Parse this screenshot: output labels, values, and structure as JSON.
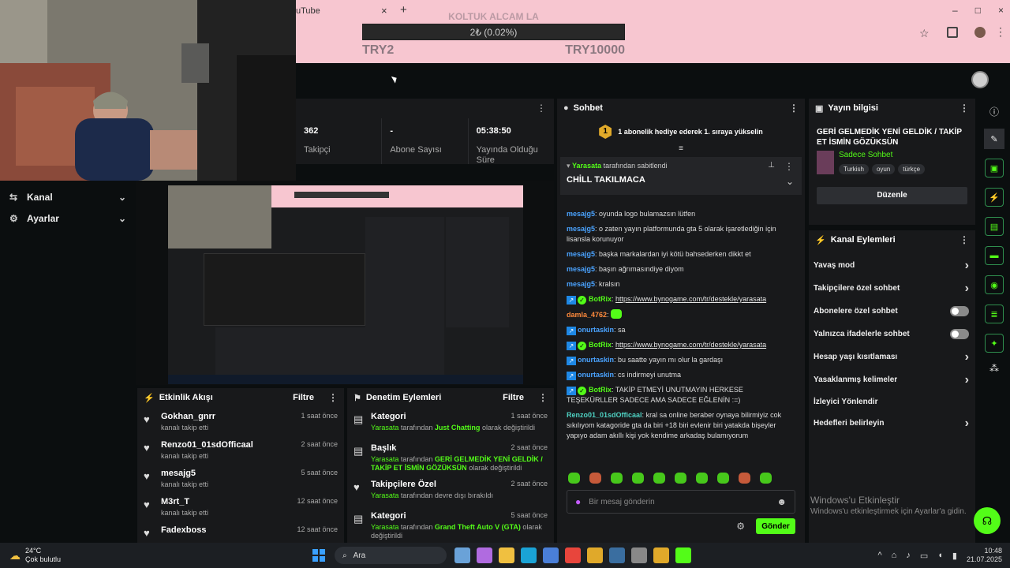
{
  "browser": {
    "tab_title": "uTube",
    "tab_close": "×",
    "new_tab": "+",
    "window_controls": [
      "–",
      "□",
      "×"
    ]
  },
  "goal": {
    "title": "KOLTUK ALCAM LA",
    "progress_text": "2₺ (0.02%)",
    "progress_fraction": 0.0002,
    "min_label": "TRY2",
    "max_label": "TRY10000"
  },
  "stats": [
    {
      "value": "362",
      "label": "Takipçi"
    },
    {
      "value": "-",
      "label": "Abone Sayısı"
    },
    {
      "value": "05:38:50",
      "label": "Yayında Olduğu Süre"
    }
  ],
  "sidebar": {
    "items": [
      {
        "label": "Kanal",
        "icon": "channel-icon"
      },
      {
        "label": "Ayarlar",
        "icon": "gear-icon"
      }
    ]
  },
  "activity_feed": {
    "title": "Etkinlik Akışı",
    "filter": "Filtre",
    "items": [
      {
        "name": "Gokhan_gnrr",
        "sub": "kanalı takip etti",
        "time": "1 saat önce"
      },
      {
        "name": "Renzo01_01sdOfficaal",
        "sub": "kanalı takip etti",
        "time": "2 saat önce"
      },
      {
        "name": "mesajg5",
        "sub": "kanalı takip etti",
        "time": "5 saat önce"
      },
      {
        "name": "M3rt_T",
        "sub": "kanalı takip etti",
        "time": "12 saat önce"
      },
      {
        "name": "Fadexboss",
        "sub": "",
        "time": "12 saat önce"
      }
    ]
  },
  "moderation": {
    "title": "Denetim Eylemleri",
    "filter": "Filtre",
    "items": [
      {
        "title": "Kategori",
        "time": "1 saat önce",
        "actor": "Yarasata",
        "mid": "tarafından",
        "value": "Just Chatting",
        "tail": "olarak değiştirildi"
      },
      {
        "title": "Başlık",
        "time": "2 saat önce",
        "actor": "Yarasata",
        "mid": "tarafından",
        "value": "GERİ GELMEDİK YENİ GELDİK / TAKİP ET İSMİN GÖZÜKSÜN",
        "tail": "olarak değiştirildi"
      },
      {
        "title": "Takipçilere Özel",
        "time": "2 saat önce",
        "actor": "Yarasata",
        "mid": "tarafından devre dışı bırakıldı",
        "value": "",
        "tail": ""
      },
      {
        "title": "Kategori",
        "time": "5 saat önce",
        "actor": "Yarasata",
        "mid": "tarafından",
        "value": "Grand Theft Auto V (GTA)",
        "tail": "olarak değiştirildi"
      }
    ]
  },
  "chat": {
    "title": "Sohbet",
    "gift_rank": "1",
    "gift_text": "1 abonelik hediye ederek 1. sıraya yükselin",
    "pinned_by_user": "Yarasata",
    "pinned_by_suffix": "tarafından sabitlendi",
    "pinned_text": "CHİLL TAKILMACA",
    "messages": [
      {
        "user": "mesajg5",
        "cls": "u-blue",
        "text": "oyunda logo bulamazsın lütfen"
      },
      {
        "user": "mesajg5",
        "cls": "u-blue",
        "text": "o zaten yayın platformunda gta 5 olarak işaretlediğin için lisansla korunuyor"
      },
      {
        "user": "mesajg5",
        "cls": "u-blue",
        "text": "başka markalardan iyi kötü bahsederken dikkt et"
      },
      {
        "user": "mesajg5",
        "cls": "u-blue",
        "text": "başın ağrımasındiye diyom"
      },
      {
        "user": "mesajg5",
        "cls": "u-blue",
        "text": "kralsın"
      },
      {
        "user": "BotRix",
        "cls": "u-green",
        "bot": true,
        "text": "https://www.bynogame.com/tr/destekle/yarasata",
        "link": true
      },
      {
        "user": "damla_4762",
        "cls": "u-orange",
        "text": "",
        "emote": true
      },
      {
        "user": "onurtaskin",
        "cls": "u-blue",
        "badge": true,
        "text": "sa"
      },
      {
        "user": "BotRix",
        "cls": "u-green",
        "bot": true,
        "text": "https://www.bynogame.com/tr/destekle/yarasata",
        "link": true
      },
      {
        "user": "onurtaskin",
        "cls": "u-blue",
        "badge": true,
        "text": "bu saatte yayın mı olur la gardaşı"
      },
      {
        "user": "onurtaskin",
        "cls": "u-blue",
        "badge": true,
        "text": "cs indirmeyi unutma"
      },
      {
        "user": "BotRix",
        "cls": "u-green",
        "bot": true,
        "text": "TAKİP ETMEYİ UNUTMAYIN HERKESE TEŞEKÜRLLER SADECE AMA SADECE EĞLENİN :=)"
      },
      {
        "user": "Renzo01_01sdOfficaal",
        "cls": "u-teal",
        "text": "kral sa online beraber oynaya bilirmiyiz cok sıkılıyom katagoride gta da biri +18 biri evlenir biri yatakda bişeyler yapıyo adam akıllı kişi yok kendime arkadaş bulamıyorum"
      }
    ],
    "input_placeholder": "Bir mesaj gönderin",
    "send_label": "Gönder"
  },
  "stream_info": {
    "title": "Yayın bilgisi",
    "stream_title": "GERİ GELMEDİK YENİ GELDİK / TAKİP ET İSMİN GÖZÜKSÜN",
    "category": "Sadece Sohbet",
    "tags": [
      "Turkish",
      "oyun",
      "türkçe"
    ],
    "edit_label": "Düzenle"
  },
  "channel_actions": {
    "title": "Kanal Eylemleri",
    "items": [
      {
        "label": "Yavaş mod",
        "type": "chevron"
      },
      {
        "label": "Takipçilere özel sohbet",
        "type": "chevron"
      },
      {
        "label": "Abonelere özel sohbet",
        "type": "toggle"
      },
      {
        "label": "Yalnızca ifadelerle sohbet",
        "type": "toggle"
      },
      {
        "label": "Hesap yaşı kısıtlaması",
        "type": "chevron"
      },
      {
        "label": "Yasaklanmış kelimeler",
        "type": "chevron"
      },
      {
        "label": "İzleyici Yönlendir",
        "type": "none"
      },
      {
        "label": "Hedefleri belirleyin",
        "type": "chevron"
      }
    ]
  },
  "windows_watermark": {
    "line1": "Windows'u Etkinleştir",
    "line2": "Windows'u etkinleştirmek için Ayarlar'a gidin."
  },
  "taskbar": {
    "weather_temp": "24°C",
    "weather_desc": "Çok bulutlu",
    "search": "Ara",
    "time": "10:48",
    "date": "21.07.2025"
  },
  "colors": {
    "accent": "#53fc18",
    "browser_pink": "#f7c6d0",
    "panel": "#18191b",
    "bg": "#0b0e0f"
  }
}
